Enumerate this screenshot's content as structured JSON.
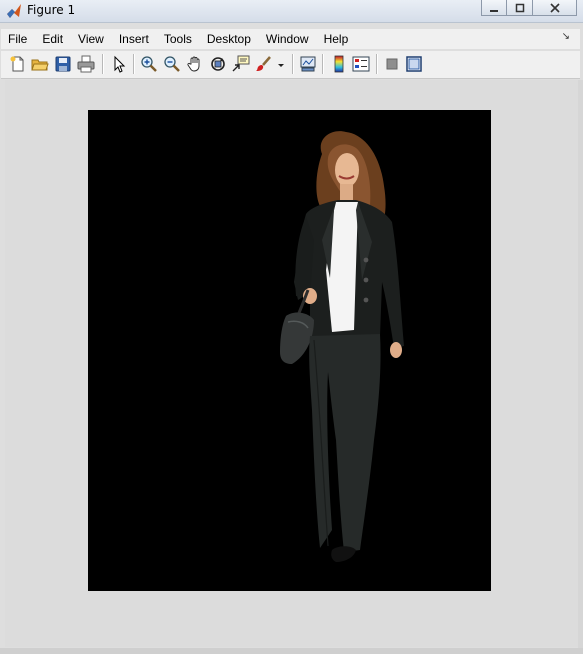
{
  "window": {
    "title": "Figure 1"
  },
  "menubar": {
    "items": [
      "File",
      "Edit",
      "View",
      "Insert",
      "Tools",
      "Desktop",
      "Window",
      "Help"
    ]
  },
  "toolbar": {
    "buttons": [
      "new-figure-icon",
      "open-file-icon",
      "save-icon",
      "print-icon",
      "edit-plot-arrow-icon",
      "zoom-in-icon",
      "zoom-out-icon",
      "pan-hand-icon",
      "rotate-3d-icon",
      "data-cursor-icon",
      "brush-icon",
      "link-plot-icon",
      "insert-colorbar-icon",
      "insert-legend-icon",
      "hide-plot-tools-icon",
      "show-plot-tools-icon"
    ]
  },
  "figure": {
    "image_description_alt": "Woman in a dark suit walking, on black background"
  }
}
